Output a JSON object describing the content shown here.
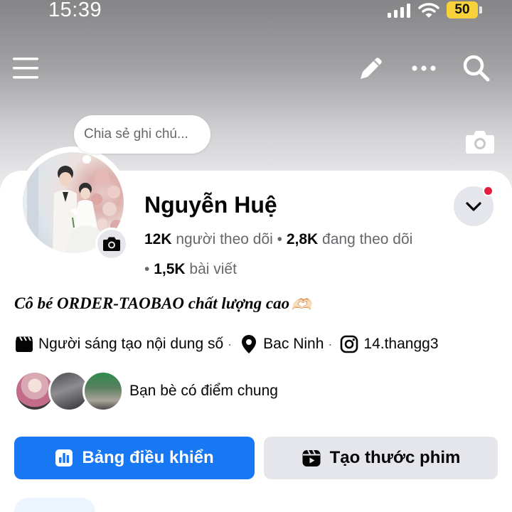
{
  "status_bar": {
    "time": "15:39",
    "battery": "50",
    "battery_color": "#f7d23a"
  },
  "top_bar": {
    "icons": [
      "menu-icon",
      "pencil-icon",
      "more-icon",
      "search-icon"
    ]
  },
  "note": {
    "placeholder": "Chia sẻ ghi chú..."
  },
  "profile": {
    "name": "Nguyễn Huệ",
    "followers_count": "12K",
    "followers_label": "người theo dõi",
    "following_count": "2,8K",
    "following_label": "đang theo dõi",
    "posts_count": "1,5K",
    "posts_label": "bài viết",
    "bio": "Cô bé ORDER-TAOBAO chất lượng cao",
    "bio_emoji": "🫶🏻"
  },
  "details": {
    "category": "Người sáng tạo nội dung số",
    "location": "Bac Ninh",
    "instagram": "14.thangg3"
  },
  "mutual_friends": {
    "label": "Bạn bè có điểm chung"
  },
  "actions": {
    "primary_label": "Bảng điều khiển",
    "secondary_label": "Tạo thước phim"
  },
  "colors": {
    "accent": "#1877f2",
    "secondary_button": "#e4e6eb",
    "notification_dot": "#e41e3f"
  }
}
